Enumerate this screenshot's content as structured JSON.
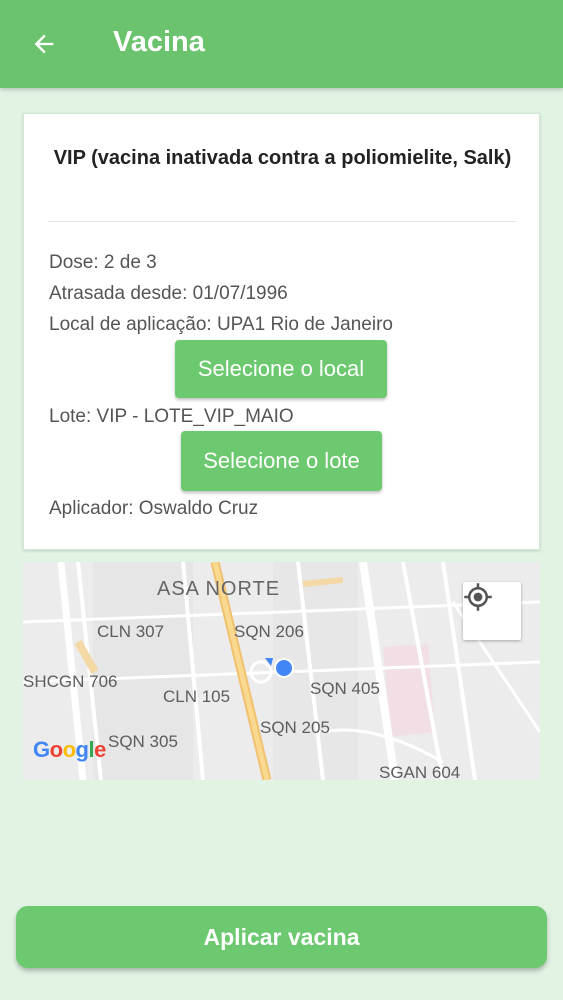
{
  "appbar": {
    "title": "Vacina",
    "back_icon": "arrow-left-icon"
  },
  "card": {
    "vaccine_name": "VIP (vacina inativada contra a poliomielite, Salk)",
    "dose": "Dose: 2 de 3",
    "overdue": "Atrasada desde: 01/07/1996",
    "location": "Local de aplicação: UPA1 Rio de Janeiro",
    "select_location_label": "Selecione o local",
    "batch": "Lote: VIP - LOTE_VIP_MAIO",
    "select_batch_label": "Selecione o lote",
    "applicator": "Aplicador:  Oswaldo Cruz"
  },
  "map": {
    "labels": {
      "asa_norte": "ASA NORTE",
      "cln_307": "CLN 307",
      "sqn_206": "SQN 206",
      "shcgn_706": "SHCGN 706",
      "cln_105": "CLN 105",
      "sqn_405": "SQN 405",
      "sqn_305": "SQN 305",
      "sqn_205": "SQN 205",
      "sgan_604": "SGAN 604"
    },
    "logo": "Google",
    "locate_icon": "my-location-icon"
  },
  "footer": {
    "apply_label": "Aplicar vacina"
  },
  "colors": {
    "primary": "#6cc36e",
    "button": "#6cc96f",
    "background": "#e2f3e3",
    "location_dot": "#4285f4"
  }
}
